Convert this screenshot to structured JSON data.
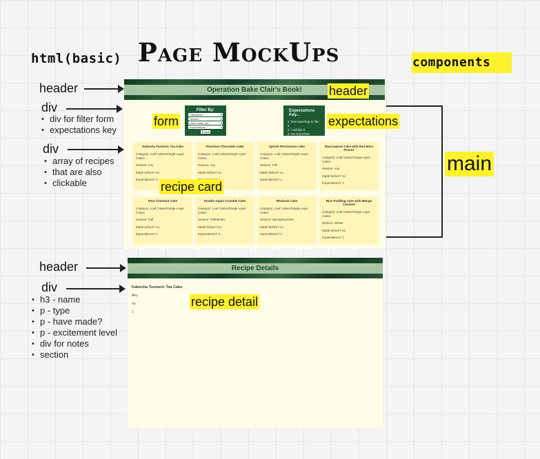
{
  "title": {
    "small": "html(basic)",
    "big": "Page MockUps",
    "components": "components"
  },
  "left_labels": {
    "header1": "header",
    "div1": "div",
    "div1_bullets": [
      "div for filter form",
      "expectations key"
    ],
    "div2": "div",
    "div2_bullets": [
      "array of recipes",
      "that are also",
      "clickable"
    ],
    "header2": "header",
    "div3": "div",
    "div3_bullets": [
      "h3 - name",
      "p - type",
      "p - have made?",
      "p - excitement level",
      "div for notes",
      "section"
    ]
  },
  "mock1": {
    "header_text": "Operation Bake Clair's Book!",
    "filter": {
      "title": "Filter By:",
      "selects": [
        "Categories...",
        "Season...",
        "Have made yet...",
        "Expectations..."
      ],
      "submit": "Submit"
    },
    "expectations": {
      "title": "Expectations Key...",
      "lines": [
        "1: Not expecting to like",
        "it",
        "2: I will like it",
        "3: SO EXCITED"
      ]
    },
    "cards": [
      {
        "title": "Kabocha Turmeric Tea Cake",
        "category": "Category: Loaf Cakes/Single-Layer Cakes",
        "season": "Season: Any",
        "made": "Made before? no",
        "expectations": "Expectations? 1"
      },
      {
        "title": "Flourless Chocolate Cake",
        "category": "Category: Loaf Cakes/Single-Layer Cakes",
        "season": "Season: Any",
        "made": "Made before? no",
        "expectations": "Expectations? 1"
      },
      {
        "title": "Spiced Persimmon Cake",
        "category": "Category: Loaf Cakes/Single-Layer Cakes",
        "season": "Season: Fall",
        "made": "Made before? no",
        "expectations": "Expectations? 1"
      },
      {
        "title": "Mascarpone Cake with Red Wine Prunes",
        "category": "Category: Loaf Cakes/Single-Layer Cakes",
        "season": "Season: Any",
        "made": "Made before? no",
        "expectations": "Expectations? 1"
      },
      {
        "title": "Pear Chestnut Cake",
        "category": "Category: Loaf Cakes/Single-Layer Cakes",
        "season": "Season: Fall",
        "made": "Made before? no",
        "expectations": "Expectations? 1"
      },
      {
        "title": "Double-Apple Crumble Cake",
        "category": "Category: Loaf Cakes/Single-Layer Cakes",
        "season": "Season: Fall/Winter",
        "made": "Made before? no",
        "expectations": "Expectations? 3"
      },
      {
        "title": "Rhubarb Cake",
        "category": "Category: Loaf Cakes/Single-Layer Cakes",
        "season": "Season: Spring/Summer",
        "made": "Made before? no",
        "expectations": "Expectations? 2"
      },
      {
        "title": "Rice Pudding Cake with Mango Caramel",
        "category": "Category: Loaf Cakes/Single-Layer Cakes",
        "season": "Season: Winter",
        "made": "Made before? no",
        "expectations": "Expectations? 1"
      }
    ]
  },
  "mock2": {
    "header_text": "Recipe Details",
    "detail": {
      "name": "Kabocha Turmeric Tea Cake",
      "type": "Any",
      "made": "no",
      "excitement": "1"
    }
  },
  "annotations": {
    "header": "header",
    "form": "form",
    "expectations": "expectations",
    "recipe_card": "recipe card",
    "main": "main",
    "recipe_detail": "recipe detail"
  },
  "colors": {
    "highlight": "#fff12e",
    "green_dark": "#1d5a34",
    "card_bg": "#fff5b8",
    "mock_bg": "#fffde8"
  }
}
